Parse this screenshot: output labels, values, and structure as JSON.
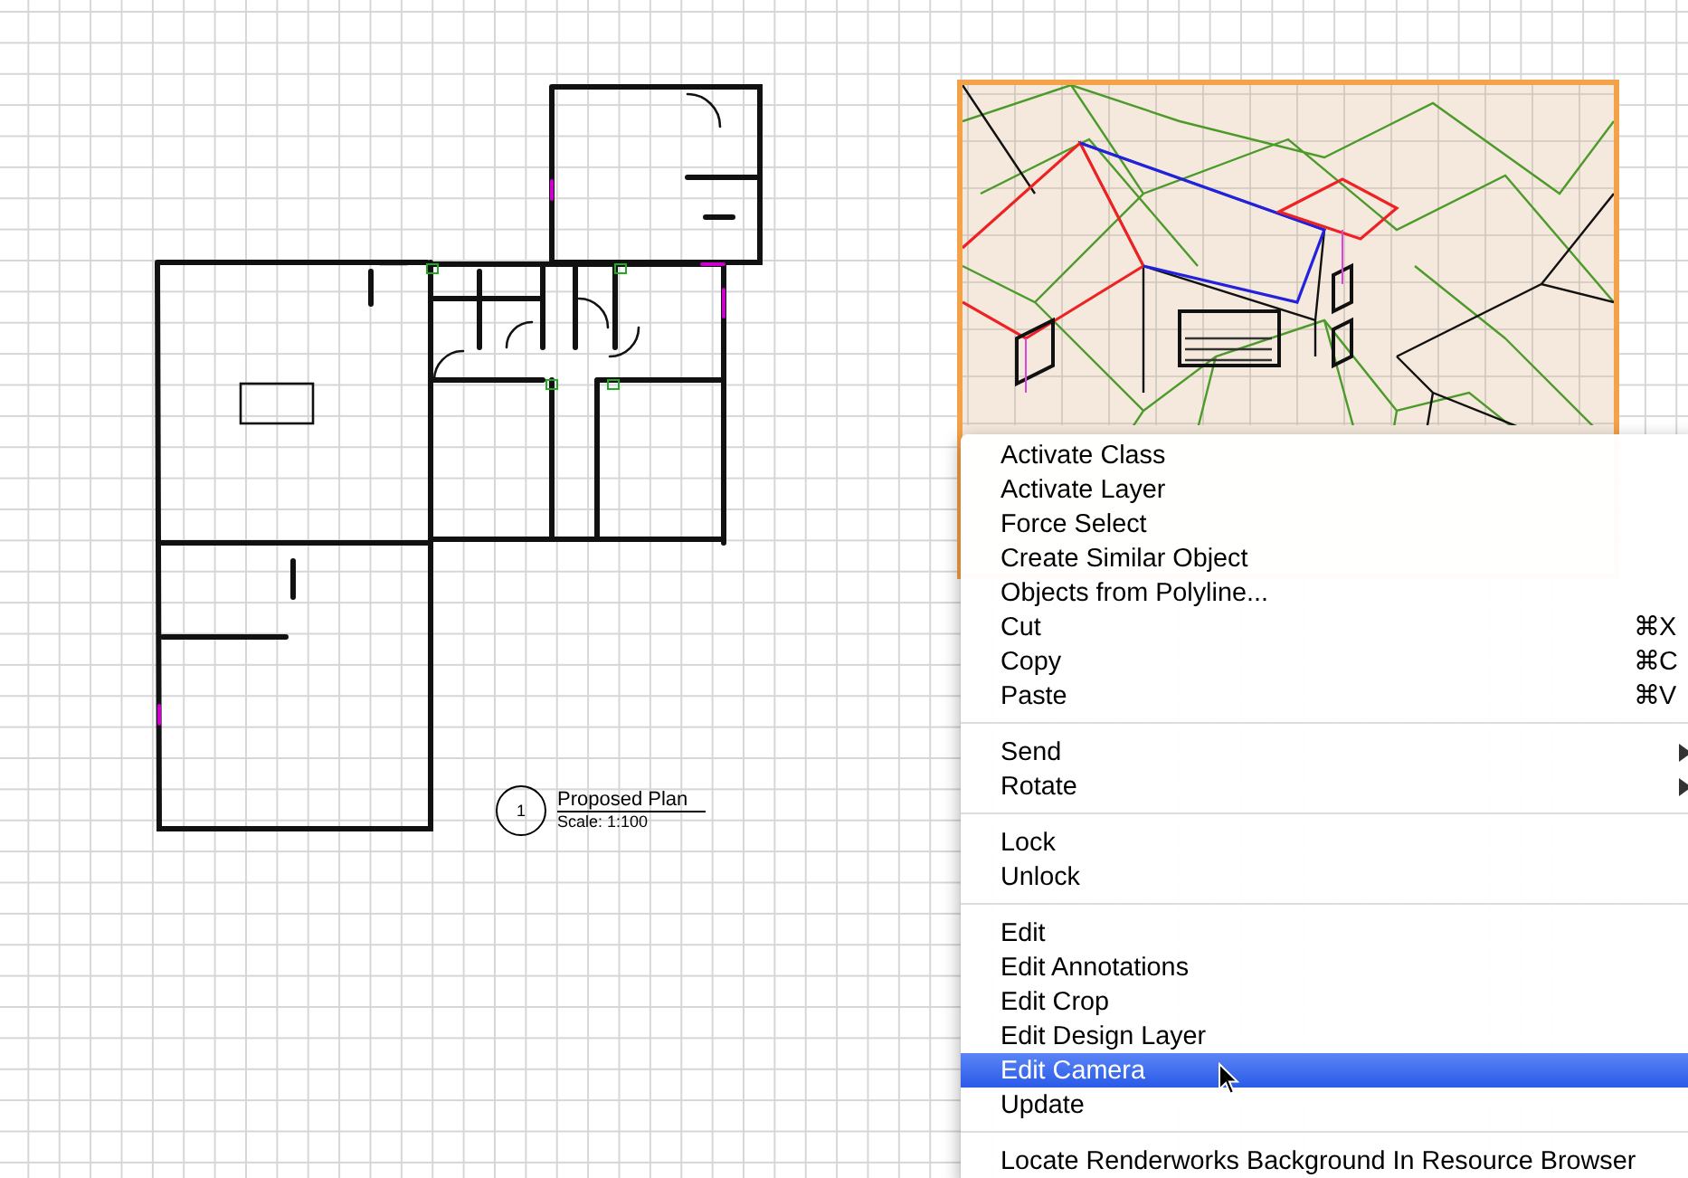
{
  "drawing_label": {
    "number": "1",
    "title": "Proposed Plan",
    "scale": "Scale: 1:100"
  },
  "context_menu": {
    "groups": [
      {
        "items": [
          {
            "label": "Activate Class",
            "selected": false
          },
          {
            "label": "Activate Layer",
            "selected": false
          },
          {
            "label": "Force Select",
            "selected": false
          },
          {
            "label": "Create Similar Object",
            "selected": false
          },
          {
            "label": "Objects from Polyline...",
            "selected": false
          },
          {
            "label": "Cut",
            "shortcut": "⌘X",
            "selected": false
          },
          {
            "label": "Copy",
            "shortcut": "⌘C",
            "selected": false
          },
          {
            "label": "Paste",
            "shortcut": "⌘V",
            "selected": false
          }
        ]
      },
      {
        "items": [
          {
            "label": "Send",
            "submenu": true,
            "selected": false
          },
          {
            "label": "Rotate",
            "submenu": true,
            "selected": false
          }
        ]
      },
      {
        "items": [
          {
            "label": "Lock",
            "selected": false
          },
          {
            "label": "Unlock",
            "selected": false
          }
        ]
      },
      {
        "items": [
          {
            "label": "Edit",
            "selected": false
          },
          {
            "label": "Edit Annotations",
            "selected": false
          },
          {
            "label": "Edit Crop",
            "selected": false
          },
          {
            "label": "Edit Design Layer",
            "selected": false
          },
          {
            "label": "Edit Camera",
            "selected": true
          },
          {
            "label": "Update",
            "selected": false
          }
        ]
      },
      {
        "items": [
          {
            "label": "Locate Renderworks Background In Resource Browser",
            "selected": false
          }
        ]
      }
    ]
  }
}
